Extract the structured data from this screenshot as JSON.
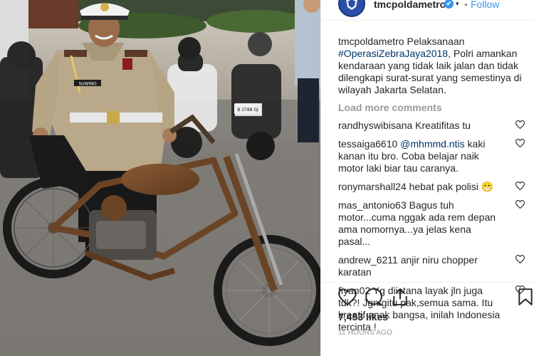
{
  "post": {
    "username": "tmcpoldametro",
    "verified_badge": "✔",
    "separator": "•",
    "follow_label": "Follow",
    "caption": {
      "user": "tmcpoldametro",
      "text_before": " Pelaksanaan ",
      "hashtag": "#OperasiZebraJaya2018",
      "text_after": ", Polri amankan kendaraan yang tidak laik jalan dan tidak dilengkapi surat-surat yang semestinya di wilayah Jakarta Selatan."
    },
    "load_more_label": "Load more comments",
    "comments": [
      {
        "user": "randhyswibisana",
        "mention": "",
        "text": " Kreatifitas tu"
      },
      {
        "user": "tessaiga6610",
        "mention": " @mhmmd.ntis",
        "text": " kaki kanan itu bro. Coba belajar naik motor laki biar tau caranya."
      },
      {
        "user": "ronymarshall24",
        "mention": "",
        "text": " hebat pak polisi 😁"
      },
      {
        "user": "mas_antonio63",
        "mention": "",
        "text": " Bagus tuh motor...cuma nggak ada rem depan ama nomornya...ya jelas kena pasal..."
      },
      {
        "user": "andrew_6211",
        "mention": "",
        "text": " anjir niru chopper karatan"
      },
      {
        "user": "fiyan02",
        "mention": "",
        "text": " Yg diistana layak jln juga tdk?! Jgn gitu pak,semua sama. Itu kreatif anak bangsa, inilah Indonesia tercinta !"
      }
    ],
    "likes": "7,453 likes",
    "timestamp": "11 HOURS AGO"
  },
  "photo": {
    "name_tag": "SUWINO",
    "plate": "B 3788 GJ"
  },
  "icons": {
    "like": "heart-icon",
    "comment": "comment-icon",
    "share": "share-icon",
    "save": "bookmark-icon",
    "comment_like": "heart-outline-icon"
  },
  "colors": {
    "link": "#3897f0",
    "hashtag": "#003569",
    "muted": "#999999",
    "text": "#262626"
  }
}
